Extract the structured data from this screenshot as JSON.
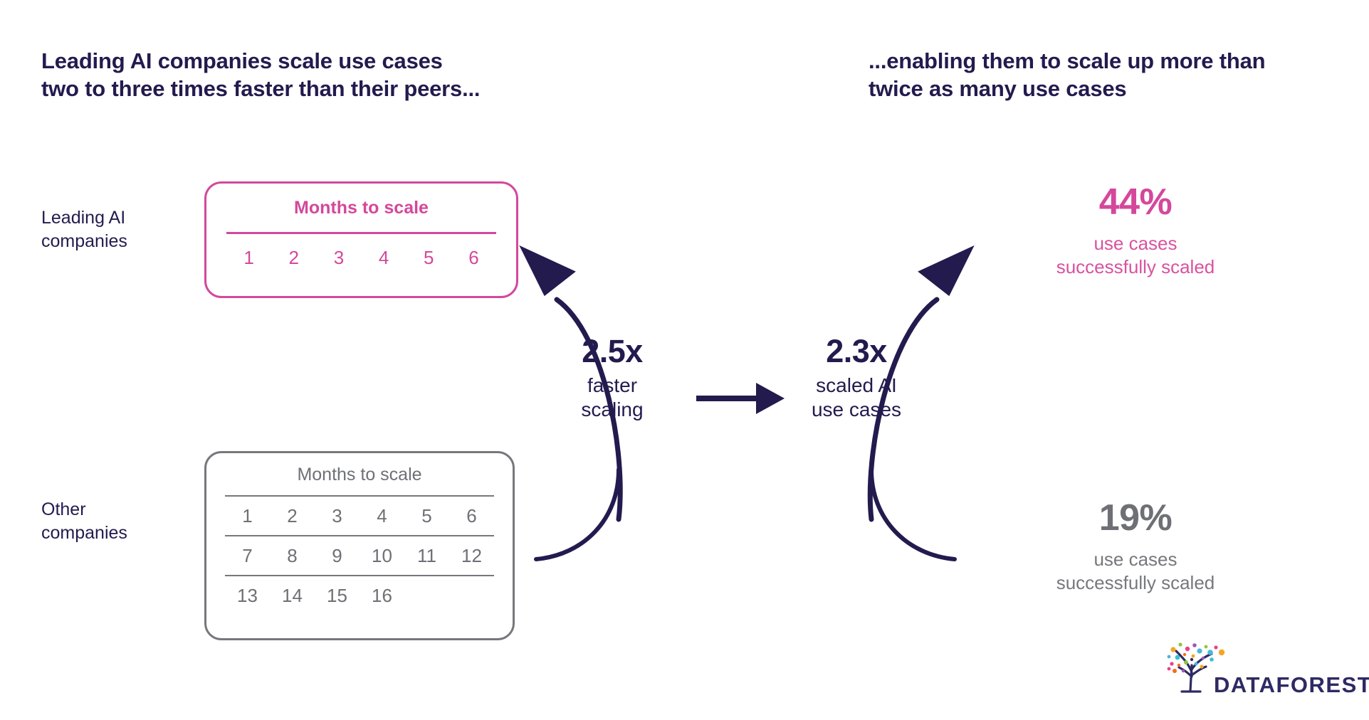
{
  "headings": {
    "left": "Leading AI companies scale use cases\ntwo to three times faster than their peers...",
    "right": "...enabling them to scale up more than\ntwice as many use cases"
  },
  "row_labels": {
    "leading": "Leading AI\ncompanies",
    "other": "Other\ncompanies"
  },
  "cards": {
    "leading": {
      "title": "Months to scale",
      "rows": [
        [
          "1",
          "2",
          "3",
          "4",
          "5",
          "6"
        ]
      ],
      "accent_color": "#d4489b"
    },
    "other": {
      "title": "Months to scale",
      "rows": [
        [
          "1",
          "2",
          "3",
          "4",
          "5",
          "6"
        ],
        [
          "7",
          "8",
          "9",
          "10",
          "11",
          "12"
        ],
        [
          "13",
          "14",
          "15",
          "16",
          "",
          ""
        ]
      ],
      "accent_color": "#77777c"
    }
  },
  "metrics": {
    "speed": {
      "value": "2.5x",
      "caption": "faster\nscaling"
    },
    "scaled": {
      "value": "2.3x",
      "caption": "scaled AI\nuse cases"
    }
  },
  "stats": {
    "leading": {
      "value": "44%",
      "caption": "use cases\nsuccessfully scaled",
      "color": "#d4489b"
    },
    "other": {
      "value": "19%",
      "caption": "use cases\nsuccessfully scaled",
      "color": "#6f7075"
    }
  },
  "arrows": {
    "leading_card_to_speed": "curved-arrow-up-left",
    "other_card_to_speed": "curved-line-down-left",
    "scaled_to_leading_stat": "curved-arrow-up-right",
    "scaled_to_other_stat": "curved-line-down-right",
    "speed_to_scaled": "straight-arrow-right"
  },
  "logo": {
    "text": "DATAFOREST",
    "text_color": "#2d2a63",
    "dot_colors": [
      "#f5a623",
      "#e8408a",
      "#3bbfd0",
      "#8cc63f",
      "#9b59b6",
      "#2d2a63",
      "#f26d21",
      "#4ab8d8"
    ]
  },
  "theme": {
    "ink": "#231b4e",
    "pink": "#d4489b",
    "gray": "#6f7075",
    "background": "#ffffff"
  }
}
